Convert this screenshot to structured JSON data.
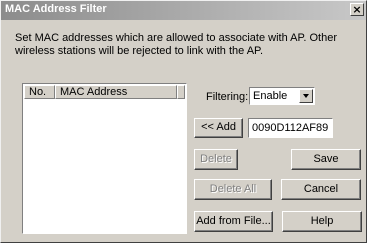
{
  "window": {
    "title": "MAC Address Filter",
    "close_glyph": "×"
  },
  "description": "Set MAC addresses which are allowed to associate with AP. Other wireless stations will be rejected to link with the AP.",
  "list": {
    "columns": [
      "No.",
      "MAC Address"
    ]
  },
  "filtering": {
    "label": "Filtering:",
    "selected": "Enable"
  },
  "mac_input": {
    "value": "0090D112AF89"
  },
  "buttons": {
    "add": "<< Add",
    "delete": "Delete",
    "delete_all": "Delete All",
    "add_from_file": "Add from File...",
    "save": "Save",
    "cancel": "Cancel",
    "help": "Help"
  },
  "colors": {
    "face": "#d4d0c8",
    "disabled_text": "#808080"
  }
}
